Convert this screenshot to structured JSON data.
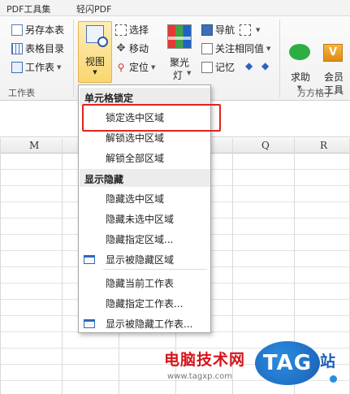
{
  "tabs": [
    {
      "label": "PDF工具集"
    },
    {
      "label": "轻闪PDF"
    }
  ],
  "ribbon": {
    "workbook_group": {
      "items": [
        {
          "label": "另存本表",
          "icon": "save-sheet-icon"
        },
        {
          "label": "表格目录",
          "icon": "table-catalog-icon"
        },
        {
          "label": "工作表",
          "icon": "worksheet-icon"
        }
      ],
      "group_label": "工作表"
    },
    "view_button": {
      "label": "视图",
      "icon": "view-icon"
    },
    "selection_group": {
      "items": [
        {
          "label": "选择",
          "icon": "select-icon"
        },
        {
          "label": "移动",
          "icon": "move-icon"
        },
        {
          "label": "定位",
          "icon": "locate-icon"
        }
      ]
    },
    "spotlight_button": {
      "label": "聚光灯",
      "line1": "聚光",
      "line2": "灯",
      "icon": "spotlight-icon"
    },
    "nav_group": {
      "items": [
        {
          "label": "导航",
          "icon": "navigation-icon"
        },
        {
          "label": "关注相同值",
          "icon": "focus-icon"
        },
        {
          "label": "记忆",
          "icon": "memory-icon"
        }
      ]
    },
    "help_button": {
      "label": "求助",
      "icon": "wechat-icon"
    },
    "vip_button": {
      "label": "会员工具",
      "line1": "会员",
      "line2": "工具",
      "icon": "vip-icon",
      "glyph": "V"
    },
    "brand_group_label": "方方格子"
  },
  "grid": {
    "columns": [
      "M",
      "Q",
      "R"
    ]
  },
  "menu": {
    "sections": [
      {
        "title": "单元格锁定",
        "items": [
          {
            "label": "锁定选中区域",
            "highlighted": true
          },
          {
            "label": "解锁选中区域"
          },
          {
            "label": "解锁全部区域"
          }
        ]
      },
      {
        "title": "显示隐藏",
        "items": [
          {
            "label": "隐藏选中区域",
            "has_icon": false
          },
          {
            "label": "隐藏未选中区域",
            "has_icon": false
          },
          {
            "label": "隐藏指定区域...",
            "has_icon": false
          },
          {
            "label": "显示被隐藏区域",
            "has_icon": true,
            "icon": "window-icon"
          },
          {
            "label": "隐藏当前工作表",
            "has_icon": false
          },
          {
            "label": "隐藏指定工作表...",
            "has_icon": false
          },
          {
            "label": "显示被隐藏工作表...",
            "has_icon": true,
            "icon": "window-icon"
          }
        ]
      }
    ],
    "highlight_color": "#e0231c"
  },
  "watermark": {
    "text": "电脑技术网",
    "url": "www.tagxp.com",
    "badge": "TAG",
    "suffix": "站"
  }
}
